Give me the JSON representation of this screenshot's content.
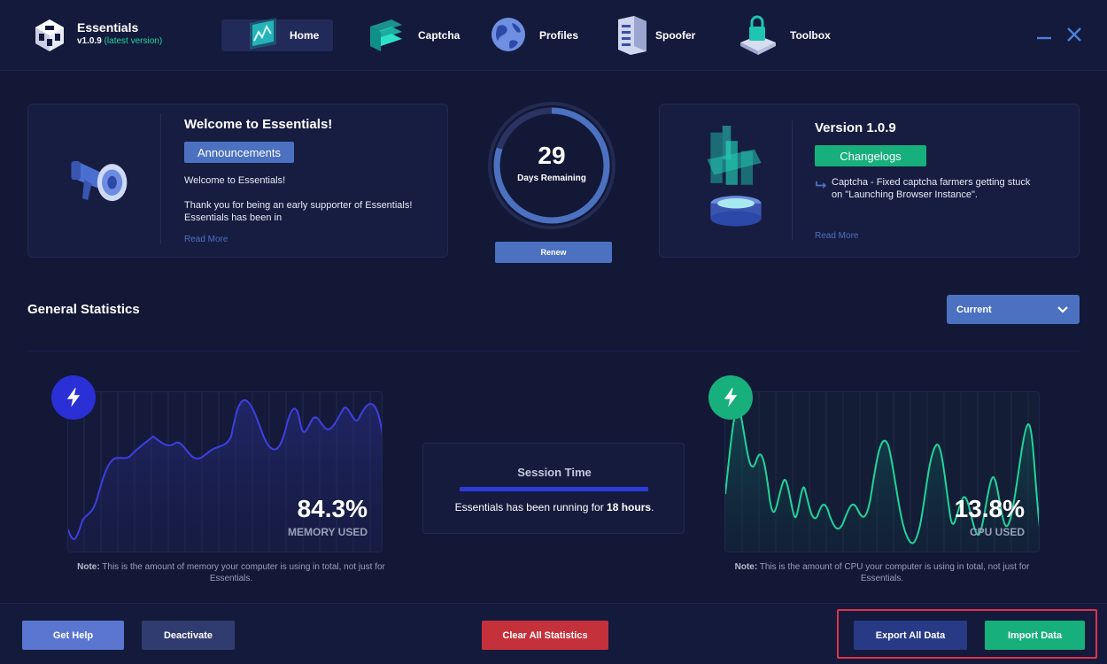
{
  "app": {
    "name": "Essentials",
    "version": "v1.0.9",
    "version_note": "(latest version)"
  },
  "nav": {
    "items": [
      {
        "label": "Home",
        "icon": "dashboard-chart-icon",
        "active": true
      },
      {
        "label": "Captcha",
        "icon": "layers-icon"
      },
      {
        "label": "Profiles",
        "icon": "globe-icon"
      },
      {
        "label": "Spoofer",
        "icon": "server-icon"
      },
      {
        "label": "Toolbox",
        "icon": "lock-box-icon"
      }
    ]
  },
  "welcome": {
    "title": "Welcome to Essentials!",
    "badge": "Announcements",
    "line1": "Welcome to Essentials!",
    "line2": "Thank you for being an early supporter of Essentials! Essentials has been in",
    "read_more": "Read More"
  },
  "license": {
    "days": "29",
    "days_label": "Days Remaining",
    "renew": "Renew",
    "remaining_fraction": 0.8
  },
  "version_card": {
    "title": "Version 1.0.9",
    "badge": "Changelogs",
    "entry": "Captcha - Fixed captcha farmers getting stuck on \"Launching Browser Instance\".",
    "read_more": "Read More"
  },
  "stats": {
    "title": "General Statistics",
    "period": "Current",
    "memory": {
      "value": "84.3%",
      "label": "MEMORY USED",
      "note_bold": "Note:",
      "note": " This is the amount of memory your computer is using in total, not just for Essentials."
    },
    "cpu": {
      "value": "13.8%",
      "label": "CPU USED",
      "note_bold": "Note:",
      "note": " This is the amount of CPU your computer is using in total, not just for Essentials."
    },
    "session": {
      "title": "Session Time",
      "text_pre": "Essentials has been running for ",
      "duration": "18 hours",
      "text_post": "."
    }
  },
  "footer": {
    "get_help": "Get Help",
    "deactivate": "Deactivate",
    "clear": "Clear All Statistics",
    "export": "Export All Data",
    "import": "Import Data"
  },
  "colors": {
    "background": "#121836",
    "accent_blue": "#4b71c0",
    "accent_green": "#17b07c",
    "danger": "#c5313b",
    "memory_line": "#3d3fe0",
    "cpu_line": "#22d39a"
  }
}
